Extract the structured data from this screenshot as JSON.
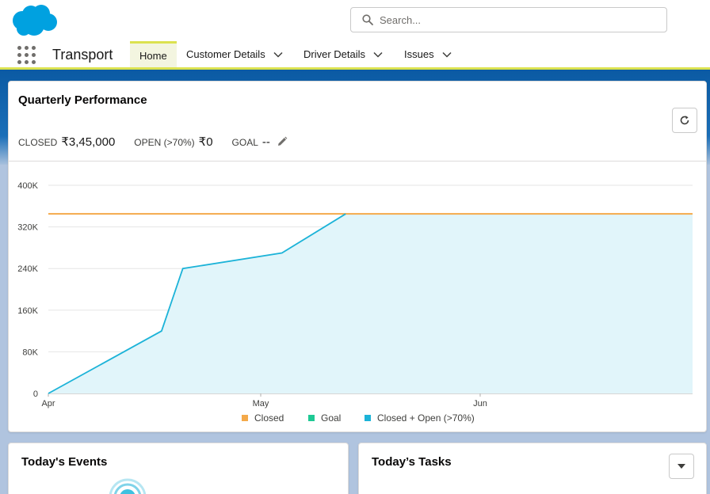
{
  "header": {
    "logo": "salesforce-cloud-logo",
    "search": {
      "placeholder": "Search..."
    }
  },
  "nav": {
    "app_name": "Transport",
    "tabs": [
      {
        "label": "Home",
        "active": true,
        "has_dropdown": false
      },
      {
        "label": "Customer Details",
        "active": false,
        "has_dropdown": true
      },
      {
        "label": "Driver Details",
        "active": false,
        "has_dropdown": true
      },
      {
        "label": "Issues",
        "active": false,
        "has_dropdown": true
      }
    ]
  },
  "performance": {
    "title": "Quarterly Performance",
    "closed_label": "CLOSED",
    "closed_value": "₹3,45,000",
    "open_label": "OPEN (>70%)",
    "open_value": "₹0",
    "goal_label": "GOAL",
    "goal_value": "--"
  },
  "chart_data": {
    "type": "line",
    "x_ticks": [
      "Apr",
      "May",
      "Jun"
    ],
    "y_ticks": [
      "0",
      "80K",
      "160K",
      "240K",
      "320K",
      "400K"
    ],
    "ylim": [
      0,
      400000
    ],
    "grid": true,
    "legend_position": "bottom",
    "legend": [
      "Closed",
      "Goal",
      "Closed + Open (>70%)"
    ],
    "series": [
      {
        "name": "Closed + Open (>70%)",
        "color": "#00a1e0",
        "x_days": [
          0,
          16,
          19,
          33,
          42,
          91
        ],
        "values": [
          0,
          120000,
          240000,
          270000,
          345000,
          345000
        ]
      },
      {
        "name": "Closed",
        "color": "#f4a94a",
        "x_days": [
          0,
          91
        ],
        "values": [
          345000,
          345000
        ]
      }
    ],
    "legend_colors": {
      "Closed": "#f4a94a",
      "Goal": "#1ec994",
      "Closed + Open (>70%)": "#1cb3d8"
    }
  },
  "events": {
    "title": "Today's Events"
  },
  "tasks": {
    "title": "Today’s Tasks"
  }
}
